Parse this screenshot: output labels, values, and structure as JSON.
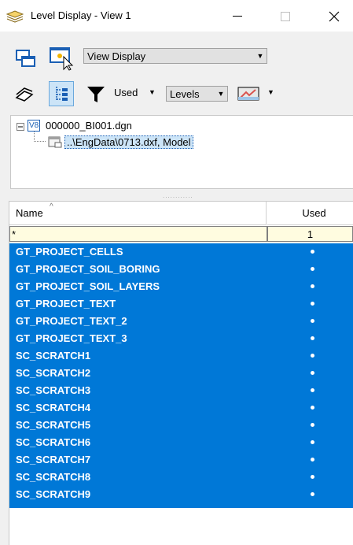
{
  "window": {
    "title": "Level Display - View 1"
  },
  "toolbar": {
    "display_mode": "View Display",
    "used_label": "Used",
    "levels_combo": "Levels"
  },
  "tree": {
    "root_badge": "V8",
    "root_label": "000000_BI001.dgn",
    "child_label": "..\\EngData\\0713.dxf, Model"
  },
  "table": {
    "columns": [
      "Name",
      "Used"
    ],
    "filter": {
      "name": "*",
      "used": "1"
    },
    "rows": [
      "GT_PROJECT_CELLS",
      "GT_PROJECT_SOIL_BORING",
      "GT_PROJECT_SOIL_LAYERS",
      "GT_PROJECT_TEXT",
      "GT_PROJECT_TEXT_2",
      "GT_PROJECT_TEXT_3",
      "SC_SCRATCH1",
      "SC_SCRATCH2",
      "SC_SCRATCH3",
      "SC_SCRATCH4",
      "SC_SCRATCH5",
      "SC_SCRATCH6",
      "SC_SCRATCH7",
      "SC_SCRATCH8",
      "SC_SCRATCH9"
    ],
    "used_flags": [
      true,
      true,
      true,
      true,
      true,
      true,
      true,
      true,
      true,
      true,
      true,
      true,
      true,
      true,
      true
    ]
  },
  "colors": {
    "selection": "#0078d7",
    "filter_bg": "#fffce0"
  }
}
